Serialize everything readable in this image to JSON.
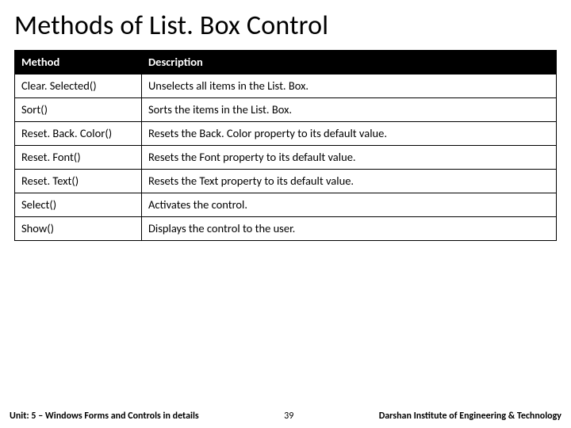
{
  "title": "Methods of List. Box Control",
  "table": {
    "head": {
      "c1": "Method",
      "c2": "Description"
    },
    "rows": [
      {
        "c1": "Clear. Selected()",
        "c2": "Unselects all items in the List. Box."
      },
      {
        "c1": "Sort()",
        "c2": "Sorts the items in the List. Box."
      },
      {
        "c1": "Reset. Back. Color()",
        "c2": "Resets the Back. Color property to its default value."
      },
      {
        "c1": "Reset. Font()",
        "c2": "Resets the Font property to its default value."
      },
      {
        "c1": "Reset. Text()",
        "c2": "Resets the Text property to its default value."
      },
      {
        "c1": "Select()",
        "c2": "Activates the control."
      },
      {
        "c1": "Show()",
        "c2": "Displays the control to the user."
      }
    ]
  },
  "footer": {
    "left": "Unit: 5 – Windows Forms and Controls in details",
    "page": "39",
    "right": "Darshan Institute of Engineering & Technology"
  }
}
